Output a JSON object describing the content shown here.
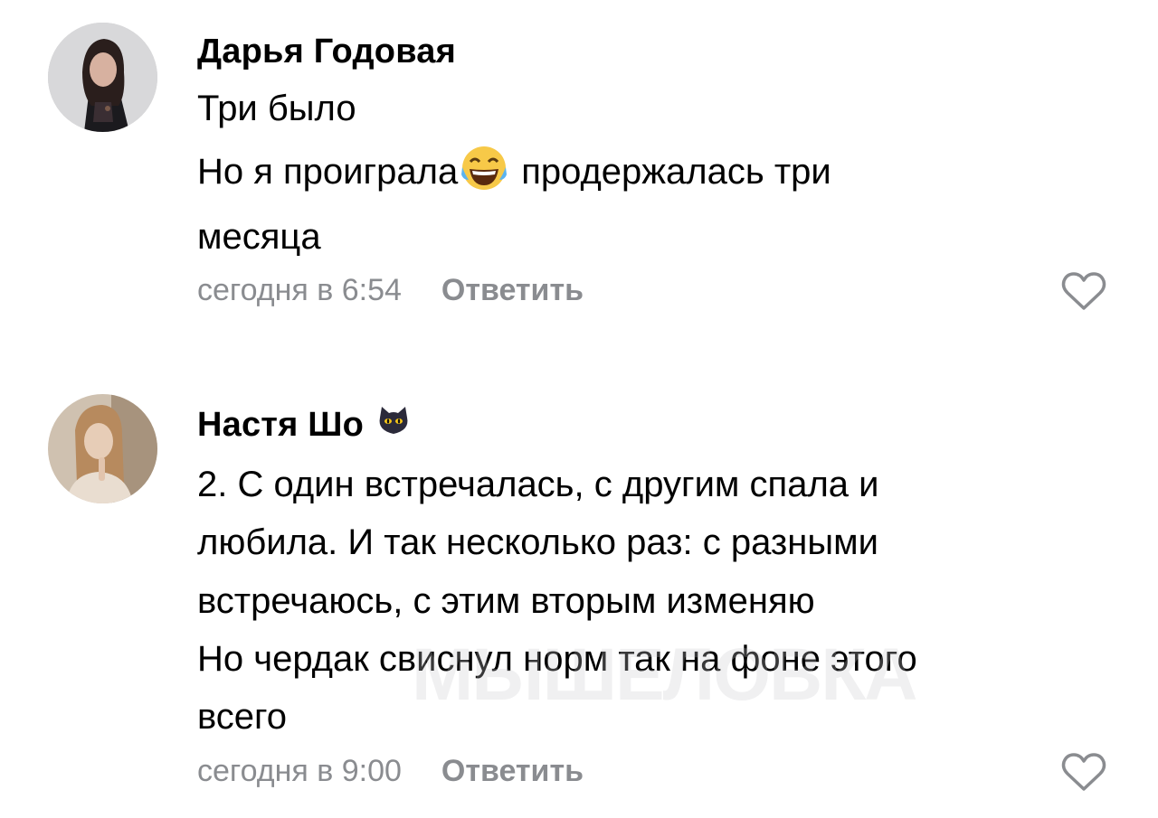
{
  "comments": [
    {
      "author": "Дарья Годовая",
      "lines": [
        "Три было",
        "Но я проиграла",
        "продержалась три",
        "месяца"
      ],
      "inline_emoji": "tears-of-joy-emoji",
      "time": "сегодня в 6:54",
      "reply_label": "Ответить",
      "like_icon": "heart-outline-icon"
    },
    {
      "author": "Настя Шо",
      "author_emoji": "black-cat-emoji",
      "lines": [
        "2. С один встречалась, с другим спала и",
        "любила. И так несколько раз: с разными",
        "встречаюсь, с этим вторым изменяю",
        "Но чердак свиснул норм так на фоне этого",
        "всего"
      ],
      "time": "сегодня в 9:00",
      "reply_label": "Ответить",
      "like_icon": "heart-outline-icon"
    }
  ],
  "watermark": "МЫШЕЛОВКА",
  "colors": {
    "text": "#000000",
    "meta": "#8a8c90",
    "background": "#ffffff"
  }
}
